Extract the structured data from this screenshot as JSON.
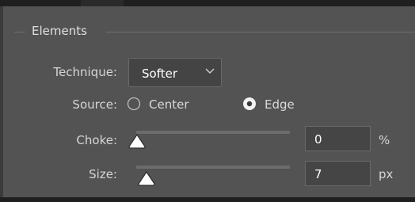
{
  "group": {
    "title": "Elements"
  },
  "technique": {
    "label": "Technique:",
    "selected": "Softer"
  },
  "source": {
    "label": "Source:",
    "options": [
      {
        "label": "Center",
        "checked": false
      },
      {
        "label": "Edge",
        "checked": true
      }
    ]
  },
  "choke": {
    "label": "Choke:",
    "value": "0",
    "unit": "%",
    "slider_fraction": 0
  },
  "size": {
    "label": "Size:",
    "value": "7",
    "unit": "px",
    "slider_fraction": 0.04
  },
  "icons": {
    "technique_dropdown": "chevron-down-icon",
    "radio_unchecked": "radio-unchecked-icon",
    "radio_checked": "radio-checked-icon",
    "slider_thumb": "slider-triangle-icon"
  },
  "colors": {
    "panel": "#535353",
    "field": "#454545",
    "text": "#d9d9d9",
    "track": "#6c6c6c"
  }
}
